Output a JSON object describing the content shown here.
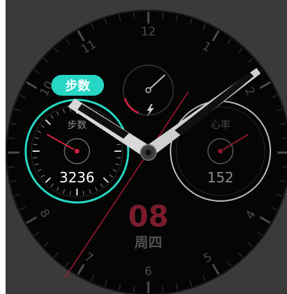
{
  "dial": {
    "hour_numbers": [
      "12",
      "1",
      "2",
      "4",
      "5",
      "6",
      "7",
      "8",
      "10",
      "11"
    ]
  },
  "steps": {
    "tag_label": "步数",
    "title": "步数",
    "value": "3236",
    "accent_color": "#27d6c4"
  },
  "heart_rate": {
    "title": "心率",
    "value": "152"
  },
  "date": {
    "day": "08",
    "weekday": "周四"
  },
  "colors": {
    "second_hand": "#c8203c",
    "frame": "#3a3a3a"
  },
  "icons": {
    "battery": "lightning-icon"
  }
}
